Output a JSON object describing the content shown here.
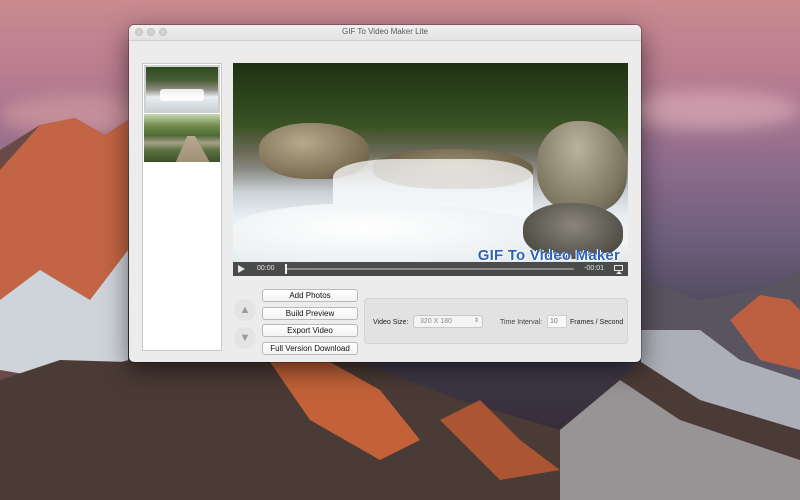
{
  "window": {
    "title": "GIF To Video Maker Lite"
  },
  "thumbnails": [
    {
      "name": "waterfall-thumbnail"
    },
    {
      "name": "forest-path-thumbnail"
    }
  ],
  "preview": {
    "watermark": "GIF To Video Maker",
    "time_current": "00:00",
    "time_remaining": "-00:01"
  },
  "buttons": {
    "add_photos": "Add Photos",
    "build_preview": "Build Preview",
    "export_video": "Export Video",
    "full_version": "Full Version Download"
  },
  "arrows": {
    "up": "▲",
    "down": "▼"
  },
  "settings": {
    "video_size_label": "Video Size:",
    "video_size_value": "320 X 180",
    "time_interval_label": "Time Interval:",
    "time_interval_value": "10",
    "fps_label": "Frames / Second"
  },
  "icons": [
    "play-icon",
    "airplay-icon",
    "chevron-updown-icon",
    "arrow-up-icon",
    "arrow-down-icon"
  ],
  "colors": {
    "watermark": "#2d63b8",
    "window_bg": "#ececec"
  }
}
